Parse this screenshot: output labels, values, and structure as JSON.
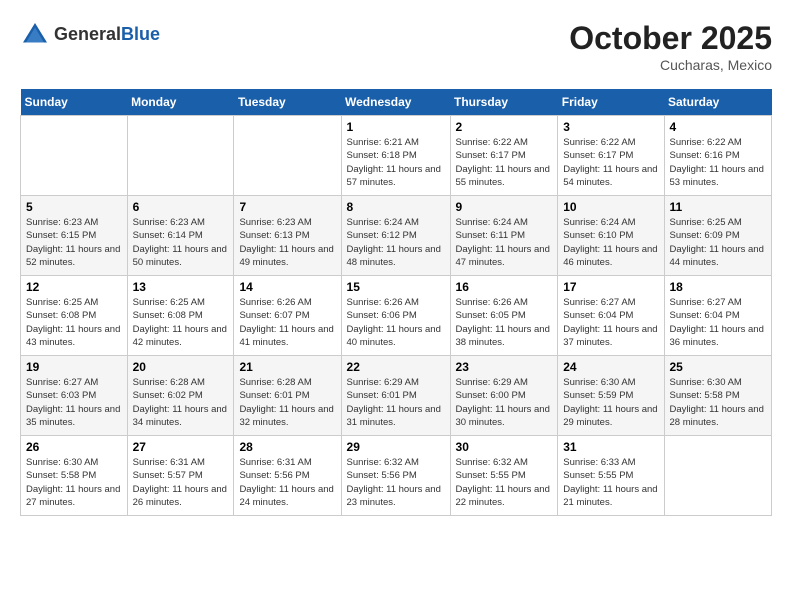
{
  "header": {
    "logo_general": "General",
    "logo_blue": "Blue",
    "month_year": "October 2025",
    "location": "Cucharas, Mexico"
  },
  "weekdays": [
    "Sunday",
    "Monday",
    "Tuesday",
    "Wednesday",
    "Thursday",
    "Friday",
    "Saturday"
  ],
  "weeks": [
    [
      {
        "day": "",
        "sunrise": "",
        "sunset": "",
        "daylight": ""
      },
      {
        "day": "",
        "sunrise": "",
        "sunset": "",
        "daylight": ""
      },
      {
        "day": "",
        "sunrise": "",
        "sunset": "",
        "daylight": ""
      },
      {
        "day": "1",
        "sunrise": "Sunrise: 6:21 AM",
        "sunset": "Sunset: 6:18 PM",
        "daylight": "Daylight: 11 hours and 57 minutes."
      },
      {
        "day": "2",
        "sunrise": "Sunrise: 6:22 AM",
        "sunset": "Sunset: 6:17 PM",
        "daylight": "Daylight: 11 hours and 55 minutes."
      },
      {
        "day": "3",
        "sunrise": "Sunrise: 6:22 AM",
        "sunset": "Sunset: 6:17 PM",
        "daylight": "Daylight: 11 hours and 54 minutes."
      },
      {
        "day": "4",
        "sunrise": "Sunrise: 6:22 AM",
        "sunset": "Sunset: 6:16 PM",
        "daylight": "Daylight: 11 hours and 53 minutes."
      }
    ],
    [
      {
        "day": "5",
        "sunrise": "Sunrise: 6:23 AM",
        "sunset": "Sunset: 6:15 PM",
        "daylight": "Daylight: 11 hours and 52 minutes."
      },
      {
        "day": "6",
        "sunrise": "Sunrise: 6:23 AM",
        "sunset": "Sunset: 6:14 PM",
        "daylight": "Daylight: 11 hours and 50 minutes."
      },
      {
        "day": "7",
        "sunrise": "Sunrise: 6:23 AM",
        "sunset": "Sunset: 6:13 PM",
        "daylight": "Daylight: 11 hours and 49 minutes."
      },
      {
        "day": "8",
        "sunrise": "Sunrise: 6:24 AM",
        "sunset": "Sunset: 6:12 PM",
        "daylight": "Daylight: 11 hours and 48 minutes."
      },
      {
        "day": "9",
        "sunrise": "Sunrise: 6:24 AM",
        "sunset": "Sunset: 6:11 PM",
        "daylight": "Daylight: 11 hours and 47 minutes."
      },
      {
        "day": "10",
        "sunrise": "Sunrise: 6:24 AM",
        "sunset": "Sunset: 6:10 PM",
        "daylight": "Daylight: 11 hours and 46 minutes."
      },
      {
        "day": "11",
        "sunrise": "Sunrise: 6:25 AM",
        "sunset": "Sunset: 6:09 PM",
        "daylight": "Daylight: 11 hours and 44 minutes."
      }
    ],
    [
      {
        "day": "12",
        "sunrise": "Sunrise: 6:25 AM",
        "sunset": "Sunset: 6:08 PM",
        "daylight": "Daylight: 11 hours and 43 minutes."
      },
      {
        "day": "13",
        "sunrise": "Sunrise: 6:25 AM",
        "sunset": "Sunset: 6:08 PM",
        "daylight": "Daylight: 11 hours and 42 minutes."
      },
      {
        "day": "14",
        "sunrise": "Sunrise: 6:26 AM",
        "sunset": "Sunset: 6:07 PM",
        "daylight": "Daylight: 11 hours and 41 minutes."
      },
      {
        "day": "15",
        "sunrise": "Sunrise: 6:26 AM",
        "sunset": "Sunset: 6:06 PM",
        "daylight": "Daylight: 11 hours and 40 minutes."
      },
      {
        "day": "16",
        "sunrise": "Sunrise: 6:26 AM",
        "sunset": "Sunset: 6:05 PM",
        "daylight": "Daylight: 11 hours and 38 minutes."
      },
      {
        "day": "17",
        "sunrise": "Sunrise: 6:27 AM",
        "sunset": "Sunset: 6:04 PM",
        "daylight": "Daylight: 11 hours and 37 minutes."
      },
      {
        "day": "18",
        "sunrise": "Sunrise: 6:27 AM",
        "sunset": "Sunset: 6:04 PM",
        "daylight": "Daylight: 11 hours and 36 minutes."
      }
    ],
    [
      {
        "day": "19",
        "sunrise": "Sunrise: 6:27 AM",
        "sunset": "Sunset: 6:03 PM",
        "daylight": "Daylight: 11 hours and 35 minutes."
      },
      {
        "day": "20",
        "sunrise": "Sunrise: 6:28 AM",
        "sunset": "Sunset: 6:02 PM",
        "daylight": "Daylight: 11 hours and 34 minutes."
      },
      {
        "day": "21",
        "sunrise": "Sunrise: 6:28 AM",
        "sunset": "Sunset: 6:01 PM",
        "daylight": "Daylight: 11 hours and 32 minutes."
      },
      {
        "day": "22",
        "sunrise": "Sunrise: 6:29 AM",
        "sunset": "Sunset: 6:01 PM",
        "daylight": "Daylight: 11 hours and 31 minutes."
      },
      {
        "day": "23",
        "sunrise": "Sunrise: 6:29 AM",
        "sunset": "Sunset: 6:00 PM",
        "daylight": "Daylight: 11 hours and 30 minutes."
      },
      {
        "day": "24",
        "sunrise": "Sunrise: 6:30 AM",
        "sunset": "Sunset: 5:59 PM",
        "daylight": "Daylight: 11 hours and 29 minutes."
      },
      {
        "day": "25",
        "sunrise": "Sunrise: 6:30 AM",
        "sunset": "Sunset: 5:58 PM",
        "daylight": "Daylight: 11 hours and 28 minutes."
      }
    ],
    [
      {
        "day": "26",
        "sunrise": "Sunrise: 6:30 AM",
        "sunset": "Sunset: 5:58 PM",
        "daylight": "Daylight: 11 hours and 27 minutes."
      },
      {
        "day": "27",
        "sunrise": "Sunrise: 6:31 AM",
        "sunset": "Sunset: 5:57 PM",
        "daylight": "Daylight: 11 hours and 26 minutes."
      },
      {
        "day": "28",
        "sunrise": "Sunrise: 6:31 AM",
        "sunset": "Sunset: 5:56 PM",
        "daylight": "Daylight: 11 hours and 24 minutes."
      },
      {
        "day": "29",
        "sunrise": "Sunrise: 6:32 AM",
        "sunset": "Sunset: 5:56 PM",
        "daylight": "Daylight: 11 hours and 23 minutes."
      },
      {
        "day": "30",
        "sunrise": "Sunrise: 6:32 AM",
        "sunset": "Sunset: 5:55 PM",
        "daylight": "Daylight: 11 hours and 22 minutes."
      },
      {
        "day": "31",
        "sunrise": "Sunrise: 6:33 AM",
        "sunset": "Sunset: 5:55 PM",
        "daylight": "Daylight: 11 hours and 21 minutes."
      },
      {
        "day": "",
        "sunrise": "",
        "sunset": "",
        "daylight": ""
      }
    ]
  ]
}
